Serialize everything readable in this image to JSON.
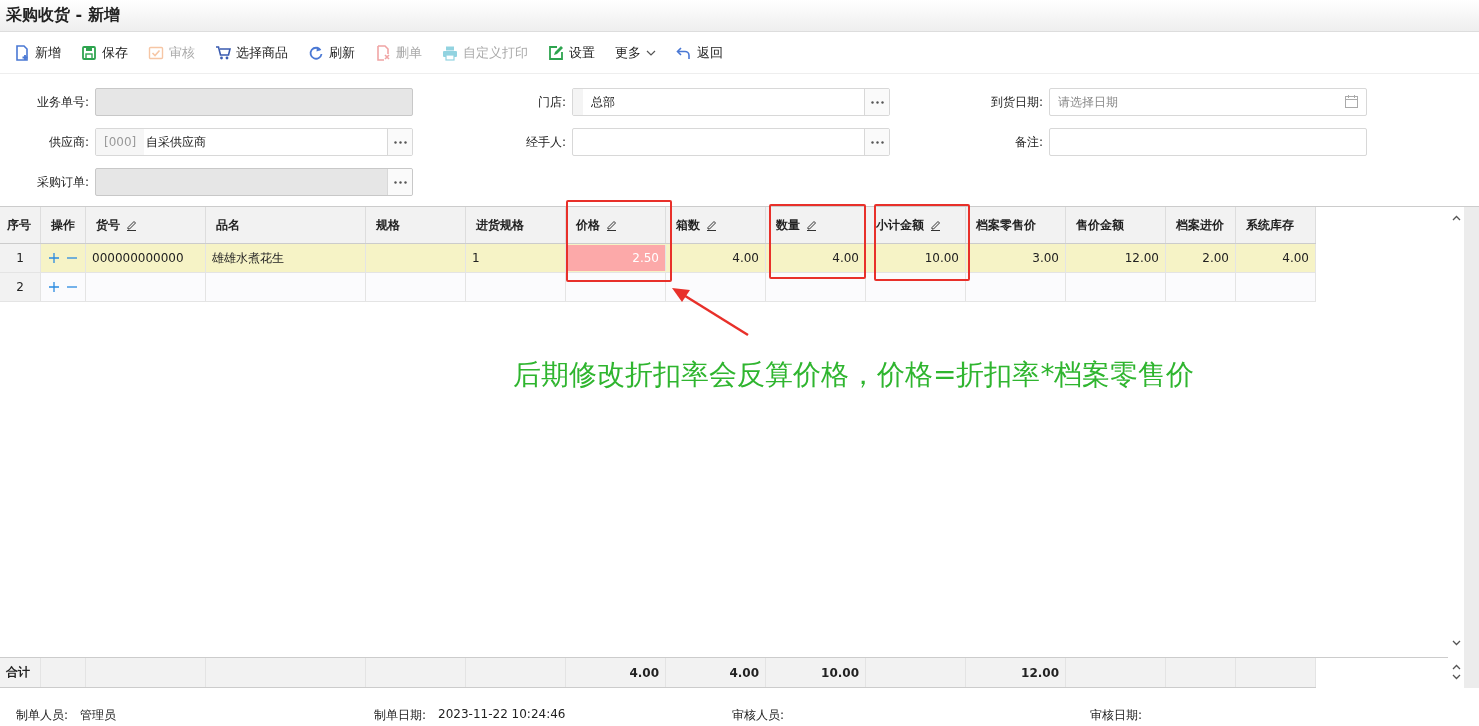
{
  "window": {
    "title": "采购收货 - 新增"
  },
  "toolbar": [
    {
      "label": "新增",
      "kind": "new",
      "disabled": false
    },
    {
      "label": "保存",
      "kind": "save",
      "disabled": false
    },
    {
      "label": "审核",
      "kind": "audit",
      "disabled": true
    },
    {
      "label": "选择商品",
      "kind": "cart",
      "disabled": false
    },
    {
      "label": "刷新",
      "kind": "refresh",
      "disabled": false
    },
    {
      "label": "删单",
      "kind": "delete",
      "disabled": true
    },
    {
      "label": "自定义打印",
      "kind": "print",
      "disabled": true
    },
    {
      "label": "设置",
      "kind": "settings",
      "disabled": false
    },
    {
      "label": "更多",
      "kind": "more",
      "disabled": false
    },
    {
      "label": "返回",
      "kind": "back",
      "disabled": false
    }
  ],
  "form": [
    {
      "label": "业务单号:",
      "kind": "plain",
      "disabled": true
    },
    {
      "label": "门店:",
      "kind": "lookup",
      "value": "总部",
      "disabled": false
    },
    {
      "label": "到货日期:",
      "kind": "date",
      "placeholder": "请选择日期",
      "disabled": false
    },
    {
      "label": "供应商:",
      "kind": "lookup",
      "prefix": "[000]",
      "value": "自采供应商",
      "disabled": false
    },
    {
      "label": "经手人:",
      "kind": "lookup",
      "disabled": false
    },
    {
      "label": "备注:",
      "kind": "plain",
      "disabled": false
    },
    {
      "label": "采购订单:",
      "kind": "lookup",
      "disabled": true
    }
  ],
  "table": {
    "columns": [
      {
        "label": "序号",
        "editable": false
      },
      {
        "label": "操作",
        "editable": false
      },
      {
        "label": "货号",
        "editable": true
      },
      {
        "label": "品名",
        "editable": false
      },
      {
        "label": "规格",
        "editable": false
      },
      {
        "label": "进货规格",
        "editable": false
      },
      {
        "label": "价格",
        "editable": true
      },
      {
        "label": "箱数",
        "editable": true
      },
      {
        "label": "数量",
        "editable": true
      },
      {
        "label": "小计金额",
        "editable": true
      },
      {
        "label": "档案零售价",
        "editable": false
      },
      {
        "label": "售价金额",
        "editable": false
      },
      {
        "label": "档案进价",
        "editable": false
      },
      {
        "label": "系统库存",
        "editable": false
      }
    ],
    "rows": [
      {
        "selected": true,
        "cells": [
          "1",
          null,
          "000000000000",
          "雄雄水煮花生",
          null,
          "1",
          {
            "text": "2.50",
            "highlighted": true
          },
          "4.00",
          "4.00",
          "10.00",
          "3.00",
          "12.00",
          "2.00",
          "4.00"
        ]
      },
      {
        "selected": false,
        "cells": [
          "2"
        ]
      }
    ],
    "totals": {
      "label": "合计",
      "cells": [
        null,
        null,
        null,
        null,
        null,
        null,
        "4.00",
        "4.00",
        "10.00",
        null,
        "12.00"
      ]
    }
  },
  "annotation": {
    "text": "后期修改折扣率会反算价格，价格=折扣率*档案零售价"
  },
  "footer": [
    {
      "label": "制单人员:",
      "value": "管理员"
    },
    {
      "label": "制单日期:",
      "value": "2023-11-22 10:24:46"
    },
    {
      "label": "审核人员:"
    },
    {
      "label": "审核日期:"
    }
  ]
}
